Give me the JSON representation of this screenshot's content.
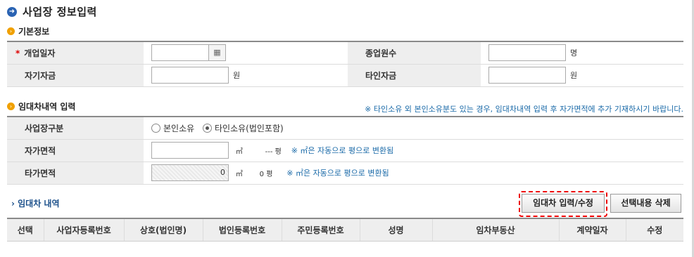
{
  "title": "사업장 정보입력",
  "sections": {
    "basic": "기본정보",
    "lease": "임대차내역 입력"
  },
  "basic": {
    "open_date_label": "개업일자",
    "open_date_required": "*",
    "employee_label": "종업원수",
    "employee_unit": "명",
    "own_fund_label": "자기자금",
    "own_fund_unit": "원",
    "other_fund_label": "타인자금",
    "other_fund_unit": "원"
  },
  "lease": {
    "notice": "※ 타인소유 외 본인소유분도 있는 경우, 임대차내역 입력 후 자가면적에 추가 기재하시기 바랍니다.",
    "type_label": "사업장구분",
    "type_options": [
      "본인소유",
      "타인소유(법인포함)"
    ],
    "type_selected": "타인소유(법인포함)",
    "self_area_label": "자가면적",
    "self_area_unit": "㎡",
    "self_area_pyeong": "--- 평",
    "other_area_label": "타가면적",
    "other_area_value": "0",
    "other_area_unit": "㎡",
    "other_area_pyeong": "0 평",
    "convert_note": "※ ㎡은 자동으로 평으로 변환됨"
  },
  "list": {
    "heading": "› 임대차 내역",
    "input_button": "임대차 입력/수정",
    "delete_button": "선택내용 삭제",
    "columns": [
      "선택",
      "사업자등록번호",
      "상호(법인명)",
      "법인등록번호",
      "주민등록번호",
      "성명",
      "임차부동산",
      "계약일자",
      "수정"
    ]
  },
  "icons": {
    "title": "arrow-circle-icon",
    "section": "section-bullet-icon",
    "calendar": "calendar-icon"
  },
  "colors": {
    "accent_blue": "#2a63b3",
    "note_blue": "#1a6aa8",
    "bullet_orange": "#f0a000",
    "highlight_red": "#e00000"
  }
}
